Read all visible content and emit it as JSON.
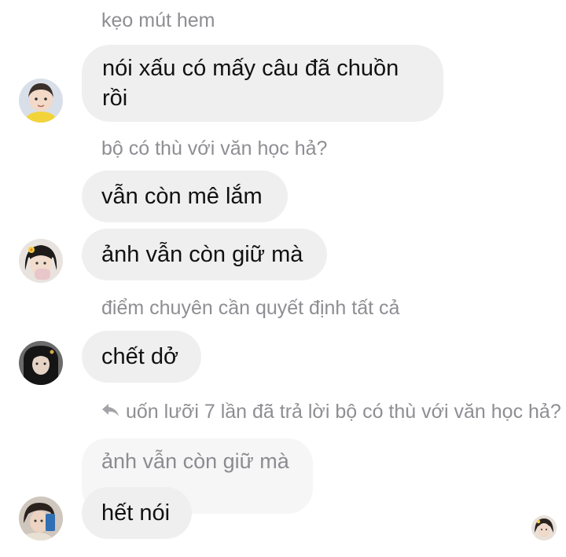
{
  "messages": [
    {
      "sender_label": "kẹo mút hem",
      "text": "nói xấu có mấy câu đã chuồn rồi",
      "avatar": "girl-yellow-shirt-avatar"
    },
    {
      "sender_label": "bộ có thù với văn học hả?",
      "texts": [
        "vẫn còn mê lắm",
        "ảnh vẫn còn giữ mà"
      ],
      "avatar": "girl-flower-hairclip-avatar"
    },
    {
      "sender_label": "điểm chuyên cần quyết định tất cả",
      "text": "chết dở",
      "avatar": "dark-hood-avatar"
    },
    {
      "reply_label": "uốn lưỡi 7 lần đã trả lời bộ có thù với văn học hả?",
      "reply_preview": "ảnh vẫn còn giữ mà",
      "text": "hết nói",
      "avatar": "girl-phone-avatar"
    }
  ],
  "icons": {
    "reply": "reply-arrow-icon",
    "seen": "seen-avatar-icon"
  }
}
